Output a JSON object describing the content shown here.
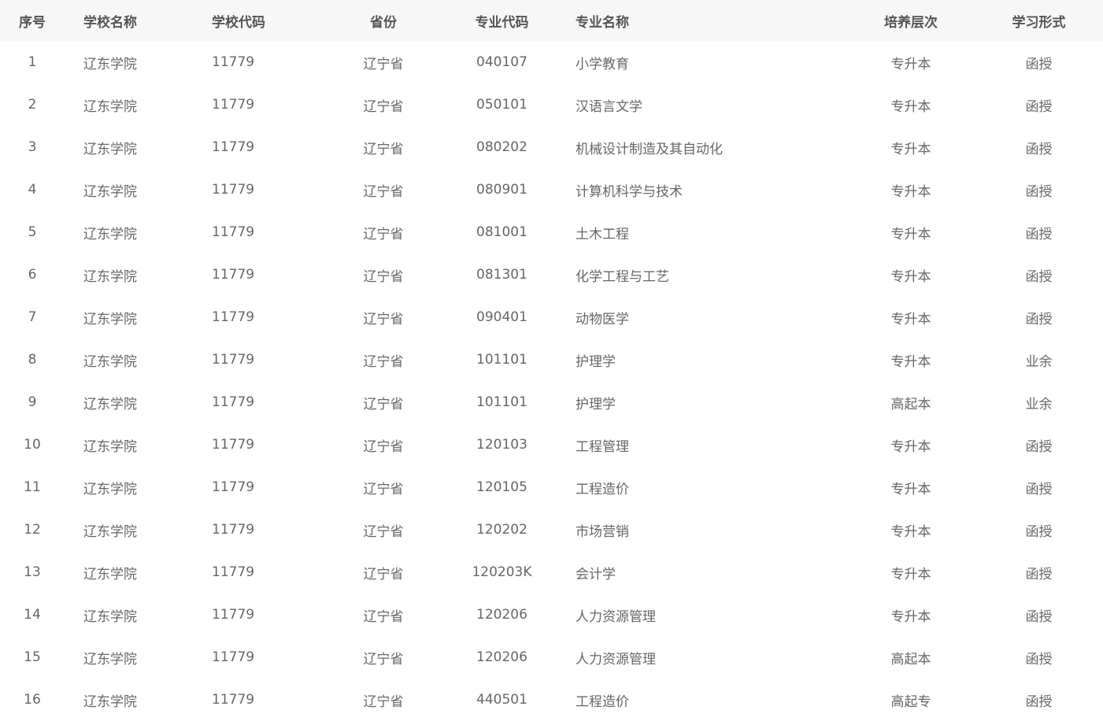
{
  "table": {
    "headers": {
      "idx": "序号",
      "school": "学校名称",
      "code": "学校代码",
      "prov": "省份",
      "mcode": "专业代码",
      "mname": "专业名称",
      "level": "培养层次",
      "form": "学习形式"
    },
    "rows": [
      {
        "idx": "1",
        "school": "辽东学院",
        "code": "11779",
        "prov": "辽宁省",
        "mcode": "040107",
        "mname": "小学教育",
        "level": "专升本",
        "form": "函授"
      },
      {
        "idx": "2",
        "school": "辽东学院",
        "code": "11779",
        "prov": "辽宁省",
        "mcode": "050101",
        "mname": "汉语言文学",
        "level": "专升本",
        "form": "函授"
      },
      {
        "idx": "3",
        "school": "辽东学院",
        "code": "11779",
        "prov": "辽宁省",
        "mcode": "080202",
        "mname": "机械设计制造及其自动化",
        "level": "专升本",
        "form": "函授"
      },
      {
        "idx": "4",
        "school": "辽东学院",
        "code": "11779",
        "prov": "辽宁省",
        "mcode": "080901",
        "mname": "计算机科学与技术",
        "level": "专升本",
        "form": "函授"
      },
      {
        "idx": "5",
        "school": "辽东学院",
        "code": "11779",
        "prov": "辽宁省",
        "mcode": "081001",
        "mname": "土木工程",
        "level": "专升本",
        "form": "函授"
      },
      {
        "idx": "6",
        "school": "辽东学院",
        "code": "11779",
        "prov": "辽宁省",
        "mcode": "081301",
        "mname": "化学工程与工艺",
        "level": "专升本",
        "form": "函授"
      },
      {
        "idx": "7",
        "school": "辽东学院",
        "code": "11779",
        "prov": "辽宁省",
        "mcode": "090401",
        "mname": "动物医学",
        "level": "专升本",
        "form": "函授"
      },
      {
        "idx": "8",
        "school": "辽东学院",
        "code": "11779",
        "prov": "辽宁省",
        "mcode": "101101",
        "mname": "护理学",
        "level": "专升本",
        "form": "业余"
      },
      {
        "idx": "9",
        "school": "辽东学院",
        "code": "11779",
        "prov": "辽宁省",
        "mcode": "101101",
        "mname": "护理学",
        "level": "高起本",
        "form": "业余"
      },
      {
        "idx": "10",
        "school": "辽东学院",
        "code": "11779",
        "prov": "辽宁省",
        "mcode": "120103",
        "mname": "工程管理",
        "level": "专升本",
        "form": "函授"
      },
      {
        "idx": "11",
        "school": "辽东学院",
        "code": "11779",
        "prov": "辽宁省",
        "mcode": "120105",
        "mname": "工程造价",
        "level": "专升本",
        "form": "函授"
      },
      {
        "idx": "12",
        "school": "辽东学院",
        "code": "11779",
        "prov": "辽宁省",
        "mcode": "120202",
        "mname": "市场营销",
        "level": "专升本",
        "form": "函授"
      },
      {
        "idx": "13",
        "school": "辽东学院",
        "code": "11779",
        "prov": "辽宁省",
        "mcode": "120203K",
        "mname": "会计学",
        "level": "专升本",
        "form": "函授"
      },
      {
        "idx": "14",
        "school": "辽东学院",
        "code": "11779",
        "prov": "辽宁省",
        "mcode": "120206",
        "mname": "人力资源管理",
        "level": "专升本",
        "form": "函授"
      },
      {
        "idx": "15",
        "school": "辽东学院",
        "code": "11779",
        "prov": "辽宁省",
        "mcode": "120206",
        "mname": "人力资源管理",
        "level": "高起本",
        "form": "函授"
      },
      {
        "idx": "16",
        "school": "辽东学院",
        "code": "11779",
        "prov": "辽宁省",
        "mcode": "440501",
        "mname": "工程造价",
        "level": "高起专",
        "form": "函授"
      }
    ]
  }
}
